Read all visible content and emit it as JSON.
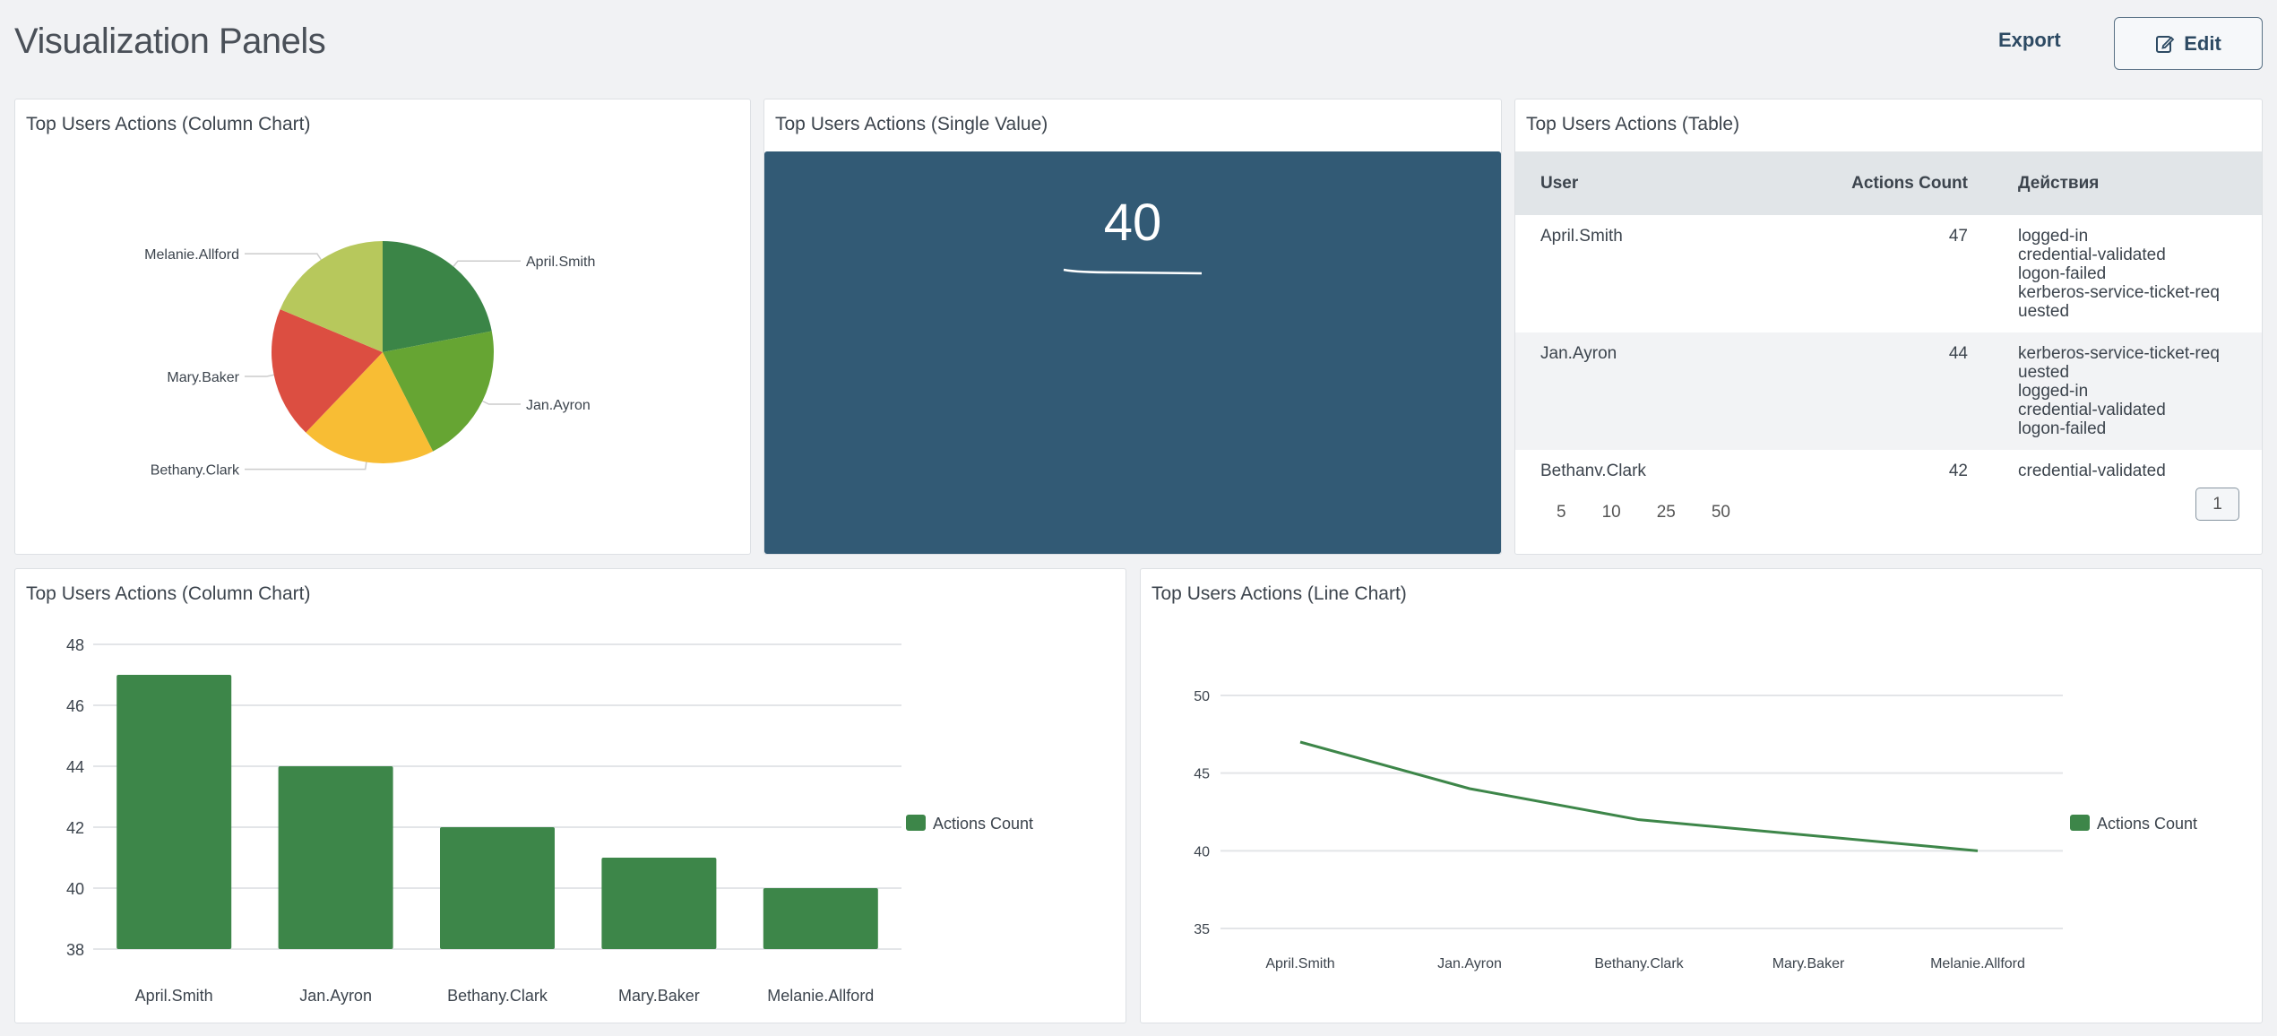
{
  "header": {
    "title": "Visualization Panels",
    "export_label": "Export",
    "edit_label": "Edit",
    "edit_icon": "edit-icon"
  },
  "panels": {
    "pie": {
      "title": "Top Users Actions (Column Chart)"
    },
    "single": {
      "title": "Top Users Actions (Single Value)",
      "value": "40"
    },
    "table": {
      "title": "Top Users Actions (Table)",
      "columns": [
        "User",
        "Actions Count",
        "Действия"
      ],
      "rows": [
        {
          "user": "April.Smith",
          "count": "47",
          "actions": [
            "logged-in",
            "credential-validated",
            "logon-failed",
            "kerberos-service-ticket-req",
            "uested"
          ]
        },
        {
          "user": "Jan.Ayron",
          "count": "44",
          "actions": [
            "kerberos-service-ticket-req",
            "uested",
            "logged-in",
            "credential-validated",
            "logon-failed"
          ]
        },
        {
          "user": "Bethanv.Clark",
          "count": "42",
          "actions": [
            "credential-validated"
          ]
        }
      ],
      "page_sizes": [
        "5",
        "10",
        "25",
        "50"
      ],
      "current_page": "1"
    },
    "column": {
      "title": "Top Users Actions (Column Chart)"
    },
    "line": {
      "title": "Top Users Actions (Line Chart)"
    }
  },
  "chart_data": [
    {
      "type": "pie",
      "categories": [
        "April.Smith",
        "Jan.Ayron",
        "Bethany.Clark",
        "Mary.Baker",
        "Melanie.Allford"
      ],
      "values": [
        47,
        44,
        42,
        41,
        40
      ],
      "colors": [
        "#3b8547",
        "#66a533",
        "#f8bd34",
        "#dc4e41",
        "#b7c85c"
      ]
    },
    {
      "type": "bar",
      "categories": [
        "April.Smith",
        "Jan.Ayron",
        "Bethany.Clark",
        "Mary.Baker",
        "Melanie.Allford"
      ],
      "series": [
        {
          "name": "Actions Count",
          "values": [
            47,
            44,
            42,
            41,
            40
          ]
        }
      ],
      "ylim": [
        38,
        48
      ],
      "yticks": [
        "38",
        "40",
        "42",
        "44",
        "46",
        "48"
      ],
      "grid": true,
      "legend": "right",
      "color": "#3d8649"
    },
    {
      "type": "line",
      "categories": [
        "April.Smith",
        "Jan.Ayron",
        "Bethany.Clark",
        "Mary.Baker",
        "Melanie.Allford"
      ],
      "series": [
        {
          "name": "Actions Count",
          "values": [
            47,
            44,
            42,
            41,
            40
          ]
        }
      ],
      "ylim": [
        35,
        50
      ],
      "yticks": [
        "35",
        "40",
        "45",
        "50"
      ],
      "grid": true,
      "legend": "right",
      "color": "#3d8649"
    }
  ]
}
